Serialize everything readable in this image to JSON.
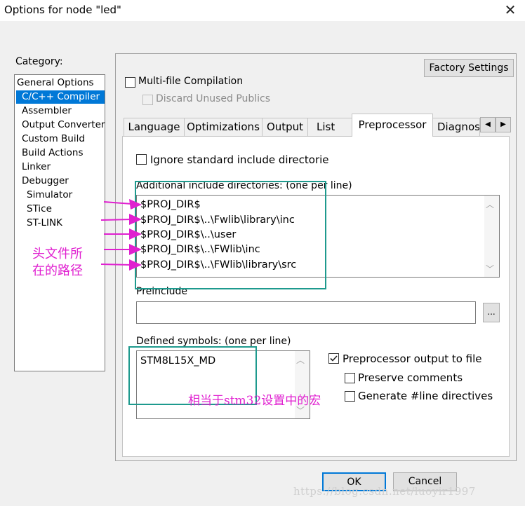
{
  "window": {
    "title": "Options for node \"led\"",
    "close_glyph": "✕"
  },
  "category": {
    "label": "Category:",
    "items": [
      {
        "label": "General Options",
        "indent": 0
      },
      {
        "label": "C/C++ Compiler",
        "indent": 1,
        "selected": true
      },
      {
        "label": "Assembler",
        "indent": 1
      },
      {
        "label": "Output Converter",
        "indent": 1
      },
      {
        "label": "Custom Build",
        "indent": 1
      },
      {
        "label": "Build Actions",
        "indent": 1
      },
      {
        "label": "Linker",
        "indent": 1
      },
      {
        "label": "Debugger",
        "indent": 1
      },
      {
        "label": "Simulator",
        "indent": 2
      },
      {
        "label": "STice",
        "indent": 2
      },
      {
        "label": "ST-LINK",
        "indent": 2
      }
    ]
  },
  "top": {
    "factory_settings": "Factory Settings",
    "multi_file": {
      "label": "Multi-file Compilation",
      "checked": false
    },
    "discard_unused": {
      "label": "Discard Unused Publics",
      "checked": false,
      "disabled": true
    }
  },
  "tabs": [
    "Language",
    "Optimizations",
    "Output",
    "List",
    "Preprocessor",
    "Diagnos"
  ],
  "active_tab": "Preprocessor",
  "tab_scroll": {
    "left": "◀",
    "right": "▶"
  },
  "preprocessor": {
    "ignore_std": {
      "label": "Ignore standard include directories",
      "checked": false
    },
    "include_label": "Additional include directories: (one per line)",
    "include_dirs": [
      "$PROJ_DIR$",
      "$PROJ_DIR$\\..\\Fwlib\\library\\inc",
      "$PROJ_DIR$\\..\\user",
      "$PROJ_DIR$\\..\\FWlib\\inc",
      "$PROJ_DIR$\\..\\FWlib\\library\\src"
    ],
    "preinclude_label": "Preinclude",
    "preinclude_value": "",
    "browse_label": "...",
    "defined_label": "Defined symbols: (one per line)",
    "defined_symbols": [
      "STM8L15X_MD"
    ],
    "pp_output": {
      "label": "Preprocessor output to file",
      "checked": true
    },
    "preserve_comments": {
      "label": "Preserve comments",
      "checked": false
    },
    "generate_line": {
      "label": "Generate #line directives",
      "checked": false
    }
  },
  "annotations": {
    "header_path_line1": "头文件所",
    "header_path_line2": "在的路径",
    "macro_note": "相当于stm32设置中的宏"
  },
  "buttons": {
    "ok": "OK",
    "cancel": "Cancel"
  },
  "watermark": "https://blog.csdn.net/luoyir1997",
  "colors": {
    "selection": "#0078d7",
    "annotation": "#e020d0",
    "highlight_box": "#1e9a8e"
  }
}
